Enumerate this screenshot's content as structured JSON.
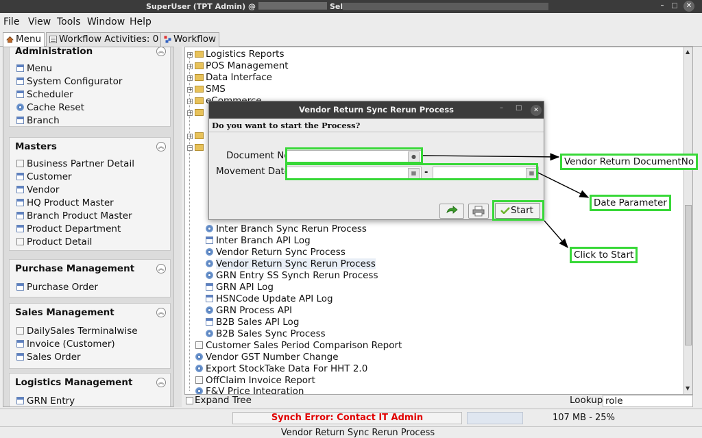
{
  "window": {
    "title_prefix": "SuperUser (TPT Admin) @",
    "title_suffix": "Selling Floor"
  },
  "menubar": [
    "File",
    "View",
    "Tools",
    "Window",
    "Help"
  ],
  "tabs": [
    "Menu",
    "Workflow Activities: 0",
    "Workflow"
  ],
  "sidebar": {
    "sections": [
      {
        "title": "Administration",
        "items": [
          "Menu",
          "System Configurator",
          "Scheduler",
          "Cache Reset",
          "Branch"
        ]
      },
      {
        "title": "Masters",
        "items": [
          "Business Partner Detail",
          "Customer",
          "Vendor",
          "HQ Product Master",
          "Branch Product Master",
          "Product Department",
          "Product Detail"
        ]
      },
      {
        "title": "Purchase Management",
        "items": [
          "Purchase Order"
        ]
      },
      {
        "title": "Sales Management",
        "items": [
          "DailySales Terminalwise",
          "Invoice (Customer)",
          "Sales Order"
        ]
      },
      {
        "title": "Logistics Management",
        "items": [
          "GRN Entry"
        ]
      }
    ]
  },
  "tree": {
    "folders": [
      "Logistics Reports",
      "POS Management",
      "Data Interface",
      "SMS",
      "eCommerce"
    ],
    "children": [
      "Inter Branch Sync Rerun Process",
      "Inter Branch API Log",
      "Vendor Return Sync Process",
      "Vendor Return Sync Rerun Process",
      "GRN Entry SS Synch Rerun Process",
      "GRN API Log",
      "HSNCode Update API Log",
      "GRN Process API",
      "B2B Sales API Log",
      "B2B Sales Sync Process"
    ],
    "root_items": [
      "Customer Sales Period Comparison Report",
      "Vendor GST Number Change",
      "Export StockTake Data For HHT 2.0",
      "OffClaim Invoice Report",
      "F&V Price Integration"
    ],
    "selected": "Vendor Return Sync Rerun Process",
    "expand_tree_label": "Expand Tree",
    "lookup_label": "Lookup",
    "lookup_value": "role"
  },
  "dialog": {
    "title": "Vendor Return Sync Rerun Process",
    "question": "Do you want to start the Process?",
    "document_no_label": "Document No",
    "movement_date_label": "Movement Date",
    "range_separator": "-",
    "start_label": "Start"
  },
  "annotations": {
    "document": "Vendor Return DocumentNo",
    "date": "Date Parameter",
    "start": "Click to Start",
    "color": "#38d838"
  },
  "status": {
    "synch_error": "Synch Error: Contact IT Admin",
    "memory": "107 MB - 25%",
    "line": "Vendor Return Sync Rerun Process"
  }
}
